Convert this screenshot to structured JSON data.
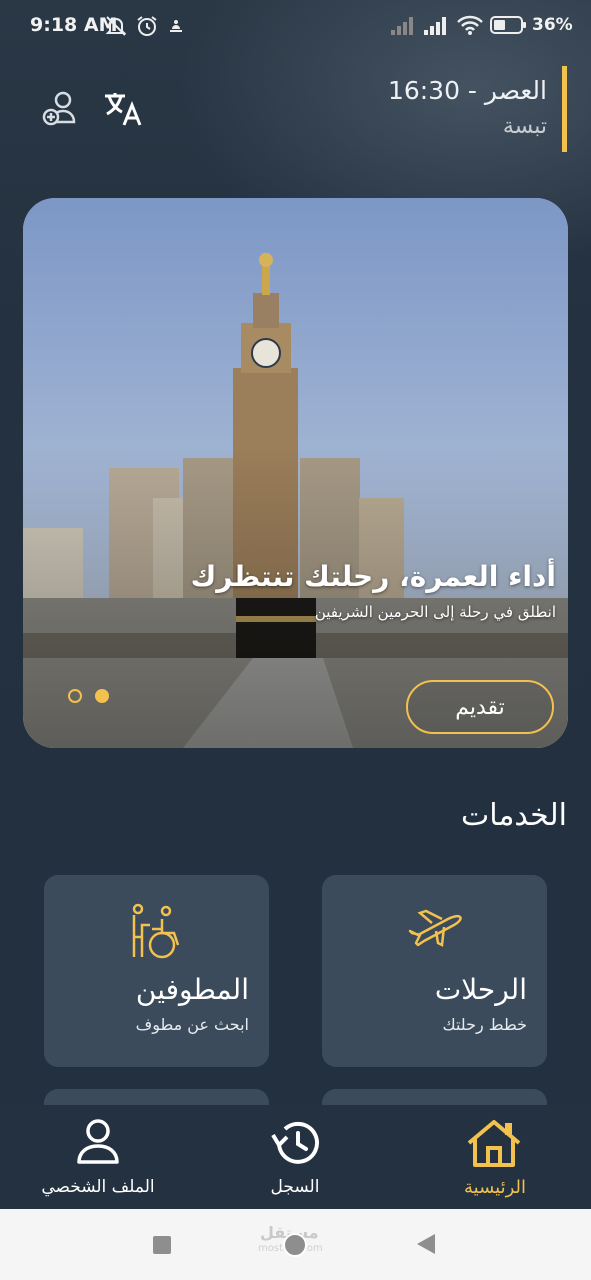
{
  "status_bar": {
    "time": "9:18 AM",
    "battery_percent": "36%",
    "icons": [
      "mute-icon",
      "alarm-icon",
      "notification-icon",
      "signal-icon",
      "signal-icon",
      "wifi-icon",
      "battery-icon"
    ]
  },
  "header": {
    "prayer": "العصر - 16:30",
    "city": "تبسة",
    "icons": [
      "add-user-icon",
      "translate-icon"
    ],
    "accent_color": "#f2c14e"
  },
  "hero": {
    "title": "أداء العمرة، رحلتك تنتظرك",
    "subtitle": "انطلق في رحلة إلى الحرمين الشريفين",
    "button_label": "تقديم",
    "slides_count": 2,
    "active_slide": 2
  },
  "services": {
    "title": "الخدمات",
    "cards": [
      {
        "title": "الرحلات",
        "subtitle": "خطط رحلتك",
        "icon": "airplane-icon"
      },
      {
        "title": "المطوفين",
        "subtitle": "ابحث عن مطوف",
        "icon": "wheelchair-assist-icon"
      }
    ]
  },
  "bottom_nav": {
    "items": [
      {
        "label": "الرئيسية",
        "icon": "home-icon",
        "active": true
      },
      {
        "label": "السجل",
        "icon": "history-icon",
        "active": false
      },
      {
        "label": "الملف الشخصي",
        "icon": "person-icon",
        "active": false
      }
    ]
  },
  "system_nav": {
    "watermark": "مستقل",
    "watermark_sub": "mostaql.com",
    "buttons": [
      "recents-button",
      "home-button",
      "back-button"
    ]
  }
}
